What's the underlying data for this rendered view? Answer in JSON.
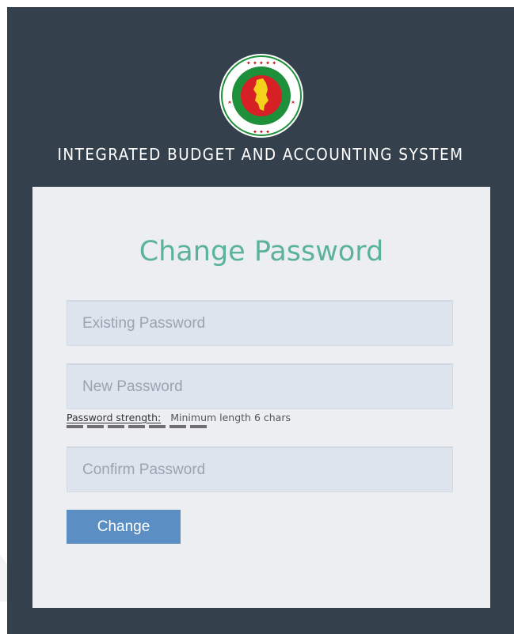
{
  "header": {
    "emblem": "bangladesh-government-emblem",
    "system_title": "INTEGRATED BUDGET AND ACCOUNTING SYSTEM"
  },
  "form": {
    "title": "Change Password",
    "existing_password_placeholder": "Existing Password",
    "new_password_placeholder": "New Password",
    "strength_label": "Password strength:",
    "strength_hint": "Minimum length 6 chars",
    "confirm_password_placeholder": "Confirm Password",
    "submit_label": "Change"
  },
  "colors": {
    "panel": "#35404d",
    "card": "#eceef2",
    "title": "#5cb39c",
    "button": "#5b8fc3",
    "field": "#dde4ee"
  }
}
